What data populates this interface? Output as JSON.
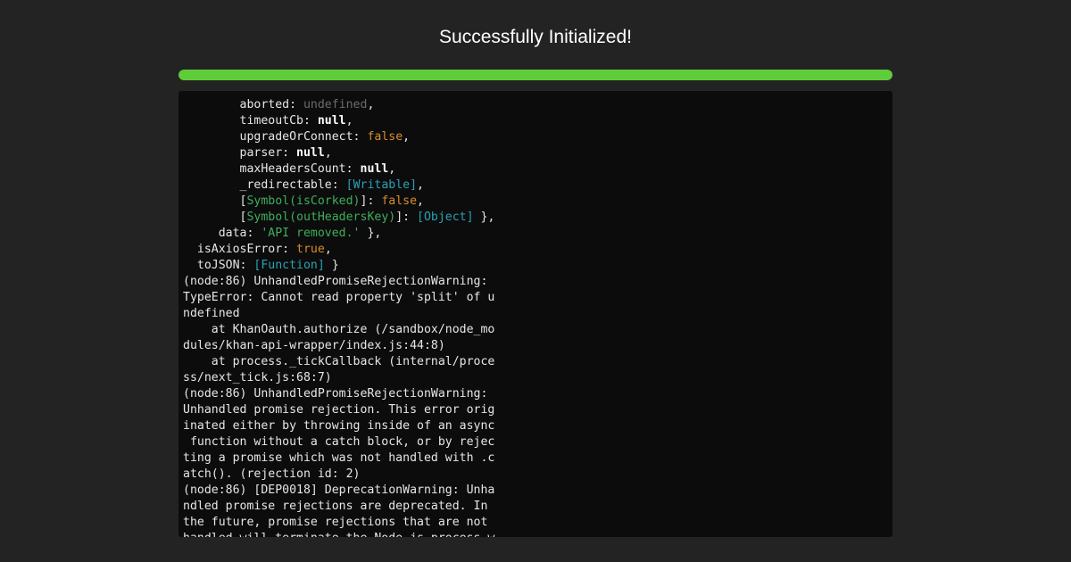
{
  "header": {
    "title": "Successfully Initialized!"
  },
  "progress": {
    "value_percent": 100,
    "color": "#5fcd3a"
  },
  "console": {
    "lines": [
      [
        {
          "t": "        aborted: ",
          "c": "default"
        },
        {
          "t": "undefined",
          "c": "undef"
        },
        {
          "t": ",",
          "c": "default"
        }
      ],
      [
        {
          "t": "        timeoutCb: ",
          "c": "default"
        },
        {
          "t": "null",
          "c": "null"
        },
        {
          "t": ",",
          "c": "default"
        }
      ],
      [
        {
          "t": "        upgradeOrConnect: ",
          "c": "default"
        },
        {
          "t": "false",
          "c": "bool"
        },
        {
          "t": ",",
          "c": "default"
        }
      ],
      [
        {
          "t": "        parser: ",
          "c": "default"
        },
        {
          "t": "null",
          "c": "null"
        },
        {
          "t": ",",
          "c": "default"
        }
      ],
      [
        {
          "t": "        maxHeadersCount: ",
          "c": "default"
        },
        {
          "t": "null",
          "c": "null"
        },
        {
          "t": ",",
          "c": "default"
        }
      ],
      [
        {
          "t": "        _redirectable: ",
          "c": "default"
        },
        {
          "t": "[Writable]",
          "c": "special"
        },
        {
          "t": ",",
          "c": "default"
        }
      ],
      [
        {
          "t": "        [",
          "c": "default"
        },
        {
          "t": "Symbol(isCorked)",
          "c": "symbol"
        },
        {
          "t": "]: ",
          "c": "default"
        },
        {
          "t": "false",
          "c": "bool"
        },
        {
          "t": ",",
          "c": "default"
        }
      ],
      [
        {
          "t": "        [",
          "c": "default"
        },
        {
          "t": "Symbol(outHeadersKey)",
          "c": "symbol"
        },
        {
          "t": "]: ",
          "c": "default"
        },
        {
          "t": "[Object]",
          "c": "special"
        },
        {
          "t": " },",
          "c": "default"
        }
      ],
      [
        {
          "t": "     data: ",
          "c": "default"
        },
        {
          "t": "'API removed.'",
          "c": "string"
        },
        {
          "t": " },",
          "c": "default"
        }
      ],
      [
        {
          "t": "  isAxiosError: ",
          "c": "default"
        },
        {
          "t": "true",
          "c": "bool"
        },
        {
          "t": ",",
          "c": "default"
        }
      ],
      [
        {
          "t": "  toJSON: ",
          "c": "default"
        },
        {
          "t": "[Function]",
          "c": "special"
        },
        {
          "t": " }",
          "c": "default"
        }
      ],
      [
        {
          "t": "(node:86) UnhandledPromiseRejectionWarning:",
          "c": "default"
        }
      ],
      [
        {
          "t": "TypeError: Cannot read property 'split' of u",
          "c": "default"
        }
      ],
      [
        {
          "t": "ndefined",
          "c": "default"
        }
      ],
      [
        {
          "t": "    at KhanOauth.authorize (/sandbox/node_mo",
          "c": "default"
        }
      ],
      [
        {
          "t": "dules/khan-api-wrapper/index.js:44:8)",
          "c": "default"
        }
      ],
      [
        {
          "t": "    at process._tickCallback (internal/proce",
          "c": "default"
        }
      ],
      [
        {
          "t": "ss/next_tick.js:68:7)",
          "c": "default"
        }
      ],
      [
        {
          "t": "(node:86) UnhandledPromiseRejectionWarning:",
          "c": "default"
        }
      ],
      [
        {
          "t": "Unhandled promise rejection. This error orig",
          "c": "default"
        }
      ],
      [
        {
          "t": "inated either by throwing inside of an async",
          "c": "default"
        }
      ],
      [
        {
          "t": " function without a catch block, or by rejec",
          "c": "default"
        }
      ],
      [
        {
          "t": "ting a promise which was not handled with .c",
          "c": "default"
        }
      ],
      [
        {
          "t": "atch(). (rejection id: 2)",
          "c": "default"
        }
      ],
      [
        {
          "t": "(node:86) [DEP0018] DeprecationWarning: Unha",
          "c": "default"
        }
      ],
      [
        {
          "t": "ndled promise rejections are deprecated. In",
          "c": "default"
        }
      ],
      [
        {
          "t": "the future, promise rejections that are not",
          "c": "default"
        }
      ],
      [
        {
          "t": "handled will terminate the Node.js process w",
          "c": "default"
        }
      ]
    ]
  }
}
